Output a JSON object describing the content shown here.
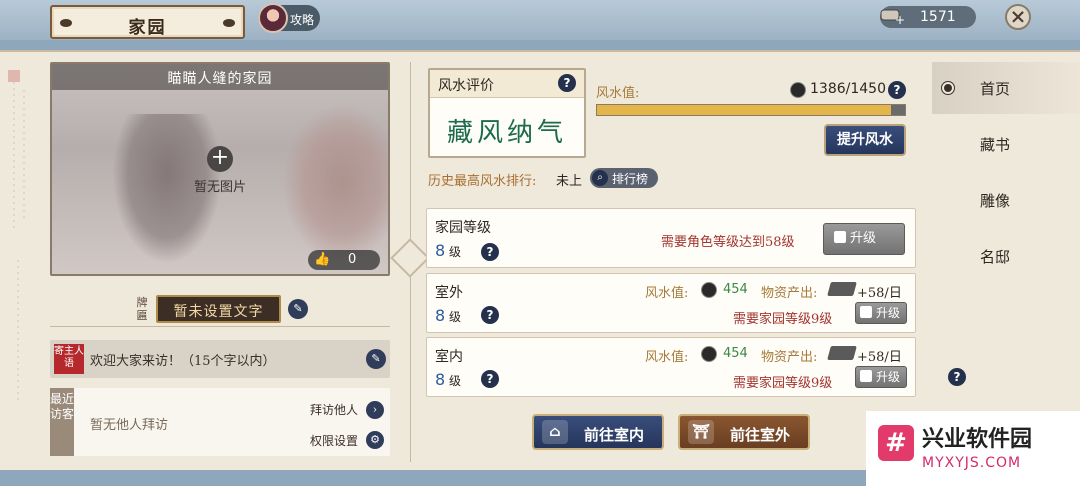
{
  "header": {
    "title": "家园",
    "guide_label": "攻略",
    "currency_value": "1571"
  },
  "photo": {
    "title": "瞄瞄人缝的家园",
    "empty_text": "暂无图片",
    "likes": "0"
  },
  "plaque": {
    "label": "牌匾",
    "text": "暂未设置文字"
  },
  "message": {
    "seal": "寄主人语",
    "text": "欢迎大家来访！（15个字以内）"
  },
  "visitors": {
    "label": "最近访客",
    "empty_text": "暂无他人拜访",
    "visit_others": "拜访他人",
    "permissions": "权限设置"
  },
  "fengshui": {
    "header": "风水评价",
    "grade": "藏风纳气",
    "value_label": "风水值:",
    "value": "1386/1450",
    "progress": 0.956,
    "improve_button": "提升风水",
    "rank_label": "历史最高风水排行:",
    "rank_value": "未上",
    "rank_button": "排行榜",
    "bar_color": "#e3b54a"
  },
  "home_level": {
    "title": "家园等级",
    "level": "8",
    "unit": "级",
    "requirement": "需要角色等级达到58级",
    "upgrade": "升级"
  },
  "outdoor": {
    "title": "室外",
    "level": "8",
    "unit": "级",
    "fs_label": "风水值:",
    "fs_value": "454",
    "mat_label": "物资产出:",
    "mat_value": "+58/日",
    "requirement": "需要家园等级9级",
    "upgrade": "升级"
  },
  "indoor": {
    "title": "室内",
    "level": "8",
    "unit": "级",
    "fs_label": "风水值:",
    "fs_value": "454",
    "mat_label": "物资产出:",
    "mat_value": "+58/日",
    "requirement": "需要家园等级9级",
    "upgrade": "升级"
  },
  "actions": {
    "go_indoor": "前往室内",
    "go_outdoor": "前往室外"
  },
  "tabs": [
    "首页",
    "藏书",
    "雕像",
    "名邸"
  ],
  "watermark": {
    "logo": "#",
    "name": "兴业软件园",
    "url": "MYXYJS.COM"
  }
}
